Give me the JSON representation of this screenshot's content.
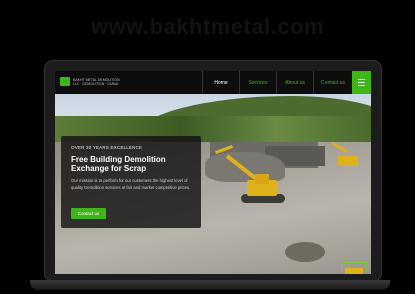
{
  "watermark": "www.bakhtmetal.com",
  "logo": {
    "line1": "BAKHT METAL DEMOLITION",
    "line2": "LLC · DEMOLITION · DUBAI"
  },
  "nav": {
    "items": [
      {
        "label": "Home",
        "active": true
      },
      {
        "label": "Services",
        "active": false
      },
      {
        "label": "About us",
        "active": false
      },
      {
        "label": "Contact us",
        "active": false
      }
    ]
  },
  "hero": {
    "kicker": "OVER 30 YEARS EXCELLENCE",
    "title": "Free Building Demolition Exchange for Scrap",
    "text": "Our mission is to perform for our customers the highest level of quality Demolition services at fair and market competitive prices.",
    "button": "Contact us"
  },
  "colors": {
    "accent": "#3fb618",
    "background": "#000000"
  }
}
